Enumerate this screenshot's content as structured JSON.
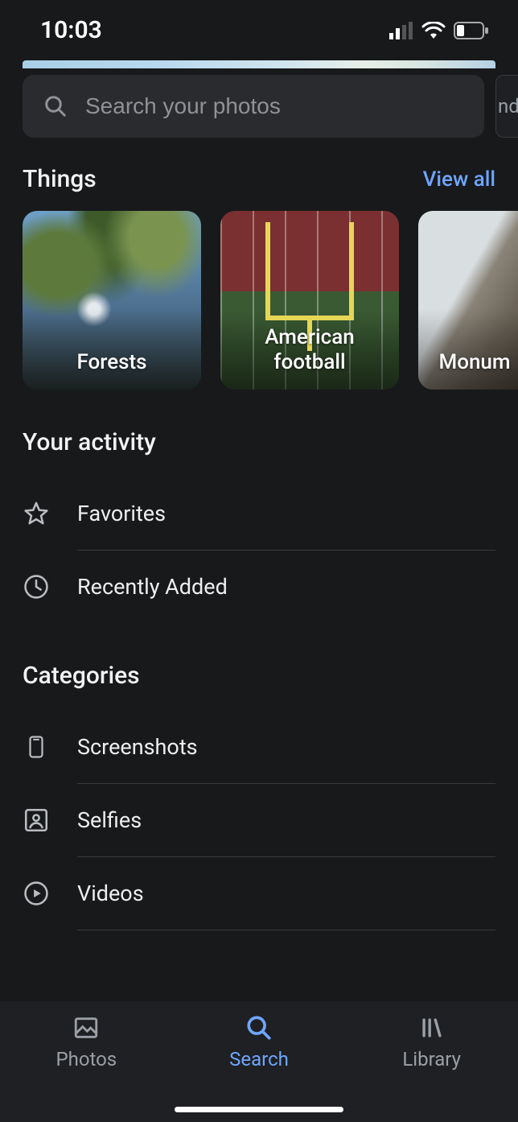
{
  "statusbar": {
    "time": "10:03"
  },
  "search": {
    "placeholder": "Search your photos"
  },
  "calendar_chip": {
    "text": "nda"
  },
  "things": {
    "title": "Things",
    "view_all": "View all",
    "items": [
      {
        "label": "Forests"
      },
      {
        "label": "American\nfootball"
      },
      {
        "label": "Monum"
      }
    ]
  },
  "activity": {
    "title": "Your activity",
    "items": [
      {
        "label": "Favorites",
        "icon": "star-icon"
      },
      {
        "label": "Recently Added",
        "icon": "clock-icon"
      }
    ]
  },
  "categories": {
    "title": "Categories",
    "items": [
      {
        "label": "Screenshots",
        "icon": "phone-icon"
      },
      {
        "label": "Selfies",
        "icon": "person-square-icon"
      },
      {
        "label": "Videos",
        "icon": "play-circle-icon"
      }
    ]
  },
  "bottomnav": {
    "items": [
      {
        "label": "Photos",
        "icon": "image-icon",
        "active": false
      },
      {
        "label": "Search",
        "icon": "search-icon",
        "active": true
      },
      {
        "label": "Library",
        "icon": "library-icon",
        "active": false
      }
    ]
  }
}
